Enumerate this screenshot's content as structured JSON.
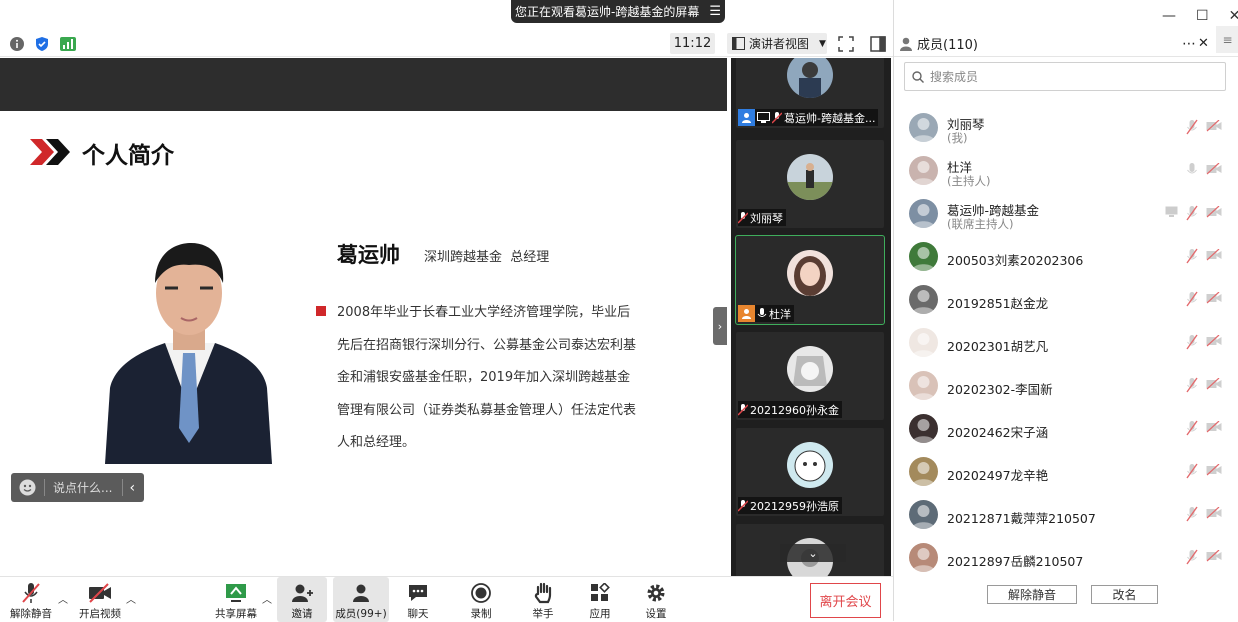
{
  "window": {
    "banner": "您正在观看葛运帅-跨越基金的屏幕",
    "time": "11:12",
    "view_mode": "演讲者视图"
  },
  "slide": {
    "title": "个人简介",
    "name": "葛运帅",
    "role": "深圳跨越基金  总经理",
    "bio": "2008年毕业于长春工业大学经济管理学院，毕业后先后在招商银行深圳分行、公募基金公司泰达宏利基金和浦银安盛基金任职，2019年加入深圳跨越基金管理有限公司（证券类私募基金管理人）任法定代表人和总经理。",
    "accent_color": "#d0282a"
  },
  "chat": {
    "placeholder": "说点什么..."
  },
  "strip": {
    "tiles": [
      {
        "label": "葛运帅-跨越基金..."
      },
      {
        "label": "刘丽琴"
      },
      {
        "label": "杜洋"
      },
      {
        "label": "20212960孙永金"
      },
      {
        "label": "20212959孙浩原"
      }
    ]
  },
  "panel": {
    "title": "成员(110)",
    "search_placeholder": "搜索成员",
    "members": [
      {
        "name": "刘丽琴",
        "role": "(我)"
      },
      {
        "name": "杜洋",
        "role": "(主持人)"
      },
      {
        "name": "葛运帅-跨越基金",
        "role": "(联席主持人)"
      },
      {
        "name": "200503刘素20202306",
        "role": ""
      },
      {
        "name": "20192851赵金龙",
        "role": ""
      },
      {
        "name": "20202301胡艺凡",
        "role": ""
      },
      {
        "name": "20202302-李国新",
        "role": ""
      },
      {
        "name": "20202462宋子涵",
        "role": ""
      },
      {
        "name": "20202497龙辛艳",
        "role": ""
      },
      {
        "name": "20212871戴萍萍210507",
        "role": ""
      },
      {
        "name": "20212897岳麟210507",
        "role": ""
      }
    ],
    "unmute_all": "解除静音",
    "rename": "改名"
  },
  "bottombar": {
    "unmute": "解除静音",
    "start_video": "开启视频",
    "share_screen": "共享屏幕",
    "invite": "邀请",
    "members": "成员(99+)",
    "chat": "聊天",
    "record": "录制",
    "raise_hand": "举手",
    "apps": "应用",
    "settings": "设置",
    "leave": "离开会议"
  }
}
